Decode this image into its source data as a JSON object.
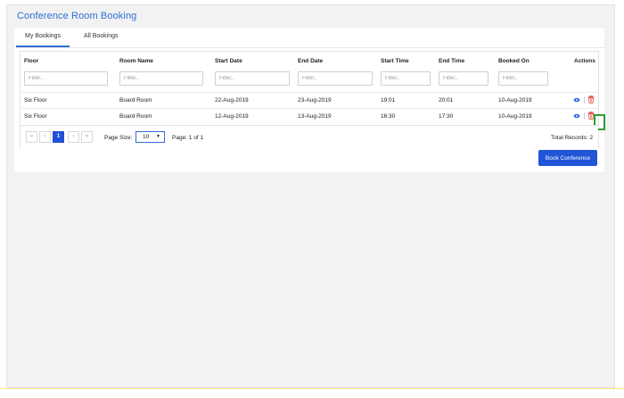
{
  "page": {
    "title": "Conference Room Booking"
  },
  "tabs": [
    {
      "label": "My Bookings",
      "active": true
    },
    {
      "label": "All Bookings",
      "active": false
    }
  ],
  "grid": {
    "columns": [
      "Floor",
      "Room Name",
      "Start Date",
      "End Date",
      "Start Time",
      "End Time",
      "Booked On",
      "Actions"
    ],
    "filter_placeholder": "Filter..",
    "rows": [
      {
        "floor": "Six Floor",
        "room": "Board Room",
        "start_date": "22-Aug-2019",
        "end_date": "23-Aug-2019",
        "start_time": "19:01",
        "end_time": "20:01",
        "booked_on": "10-Aug-2019"
      },
      {
        "floor": "Six Floor",
        "room": "Board Room",
        "start_date": "12-Aug-2019",
        "end_date": "13-Aug-2019",
        "start_time": "16:30",
        "end_time": "17:30",
        "booked_on": "10-Aug-2019"
      }
    ]
  },
  "pagination": {
    "first": "«",
    "prev": "‹",
    "current_page": "1",
    "next": "›",
    "last": "»",
    "page_size_label": "Page Size:",
    "page_size_value": "10",
    "page_info": "Page: 1 of 1",
    "total_records": "Total Records: 2"
  },
  "actions": {
    "book_button": "Book Conference",
    "view_icon": "eye-icon",
    "delete_icon": "trash-icon"
  },
  "colors": {
    "accent": "#2f6fd6",
    "button": "#1f55d6",
    "delete": "#e0453a",
    "highlight": "#2e9e2e"
  }
}
